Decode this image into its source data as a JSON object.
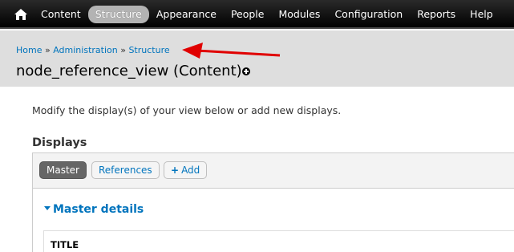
{
  "toolbar": {
    "home_icon": "home-icon",
    "items": [
      {
        "label": "Content",
        "active": false
      },
      {
        "label": "Structure",
        "active": true
      },
      {
        "label": "Appearance",
        "active": false
      },
      {
        "label": "People",
        "active": false
      },
      {
        "label": "Modules",
        "active": false
      },
      {
        "label": "Configuration",
        "active": false
      },
      {
        "label": "Reports",
        "active": false
      },
      {
        "label": "Help",
        "active": false
      }
    ]
  },
  "breadcrumb": {
    "items": [
      "Home",
      "Administration",
      "Structure"
    ],
    "separator": "»"
  },
  "page": {
    "title": "node_reference_view (Content)",
    "shortcut_icon": "add-shortcut-icon"
  },
  "content": {
    "intro": "Modify the display(s) of your view below or add new displays.",
    "displays_heading": "Displays",
    "tabs": {
      "master": "Master",
      "references": "References",
      "add": "Add",
      "add_icon": "+"
    },
    "details_toggle": "Master details",
    "title_panel_label": "TITLE"
  },
  "colors": {
    "link": "#0074bd",
    "toolbar_bg": "#000000",
    "header_bg": "#dedede",
    "annotation_arrow": "#e00000"
  }
}
